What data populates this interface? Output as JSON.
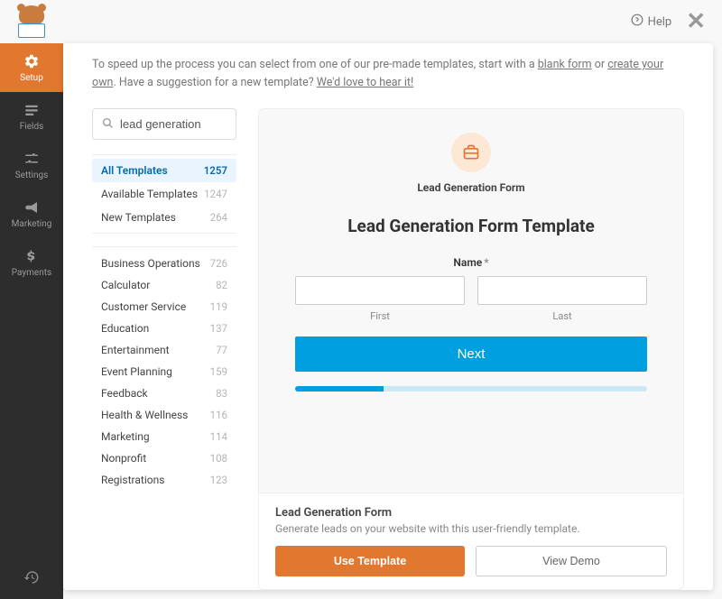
{
  "topbar": {
    "help_label": "Help"
  },
  "sidebar": {
    "items": [
      {
        "label": "Setup"
      },
      {
        "label": "Fields"
      },
      {
        "label": "Settings"
      },
      {
        "label": "Marketing"
      },
      {
        "label": "Payments"
      }
    ]
  },
  "intro": {
    "text_prefix": "To speed up the process you can select from one of our pre-made templates, start with a ",
    "blank_form": "blank form",
    "or": " or ",
    "create_own": "create your own",
    "text_suffix": ". Have a suggestion for a new template? ",
    "hear_it": "We'd love to hear it!"
  },
  "search": {
    "value": "lead generation"
  },
  "filters": [
    {
      "label": "All Templates",
      "count": "1257"
    },
    {
      "label": "Available Templates",
      "count": "1247"
    },
    {
      "label": "New Templates",
      "count": "264"
    }
  ],
  "categories": [
    {
      "label": "Business Operations",
      "count": "726"
    },
    {
      "label": "Calculator",
      "count": "82"
    },
    {
      "label": "Customer Service",
      "count": "119"
    },
    {
      "label": "Education",
      "count": "137"
    },
    {
      "label": "Entertainment",
      "count": "77"
    },
    {
      "label": "Event Planning",
      "count": "159"
    },
    {
      "label": "Feedback",
      "count": "83"
    },
    {
      "label": "Health & Wellness",
      "count": "116"
    },
    {
      "label": "Marketing",
      "count": "114"
    },
    {
      "label": "Nonprofit",
      "count": "108"
    },
    {
      "label": "Registrations",
      "count": "123"
    }
  ],
  "preview": {
    "badge_label": "Lead Generation Form",
    "title": "Lead Generation Form Template",
    "name_label": "Name",
    "required_mark": "*",
    "first_label": "First",
    "last_label": "Last",
    "next_label": "Next",
    "footer_title": "Lead Generation Form",
    "footer_desc": "Generate leads on your website with this user-friendly template.",
    "use_template": "Use Template",
    "view_demo": "View Demo"
  }
}
